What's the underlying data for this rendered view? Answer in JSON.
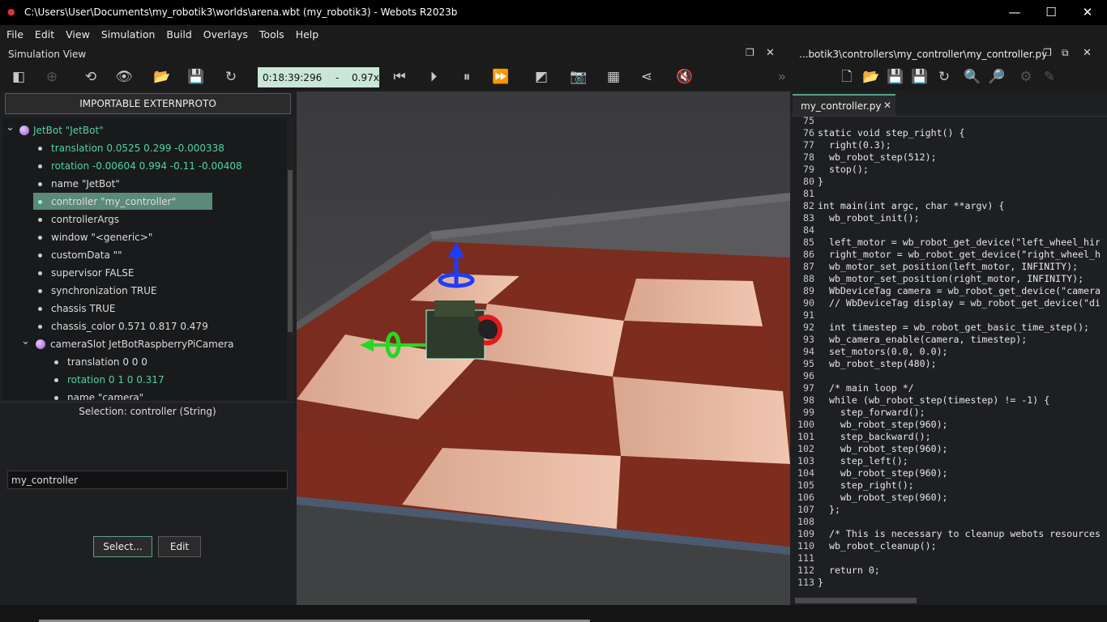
{
  "window": {
    "title": "C:\\Users\\User\\Documents\\my_robotik3\\worlds\\arena.wbt (my_robotik3) - Webots R2023b"
  },
  "menu": [
    "File",
    "Edit",
    "View",
    "Simulation",
    "Build",
    "Overlays",
    "Tools",
    "Help"
  ],
  "sim_view": {
    "title": "Simulation View",
    "time": "0:18:39:296",
    "sep": "-",
    "speed": "0.97x",
    "importable_button": "IMPORTABLE EXTERNPROTO"
  },
  "scene_tree": [
    {
      "label": "JetBot \"JetBot\"",
      "kind": "sphere",
      "level": 0,
      "expanded": true
    },
    {
      "label": "translation 0.0525 0.299 -0.000338",
      "kind": "field",
      "level": 1,
      "green": true
    },
    {
      "label": "rotation -0.00604 0.994 -0.11 -0.00408",
      "kind": "field",
      "level": 1,
      "green": true
    },
    {
      "label": "name \"JetBot\"",
      "kind": "field",
      "level": 1
    },
    {
      "label": "controller \"my_controller\"",
      "kind": "field",
      "level": 1,
      "selected": true
    },
    {
      "label": "controllerArgs",
      "kind": "field",
      "level": 1
    },
    {
      "label": "window \"<generic>\"",
      "kind": "field",
      "level": 1
    },
    {
      "label": "customData \"\"",
      "kind": "field",
      "level": 1
    },
    {
      "label": "supervisor FALSE",
      "kind": "field",
      "level": 1
    },
    {
      "label": "synchronization TRUE",
      "kind": "field",
      "level": 1
    },
    {
      "label": "chassis TRUE",
      "kind": "field",
      "level": 1
    },
    {
      "label": "chassis_color 0.571 0.817 0.479",
      "kind": "field",
      "level": 1
    },
    {
      "label": "cameraSlot JetBotRaspberryPiCamera",
      "kind": "sphere",
      "level": 1,
      "expanded": true
    },
    {
      "label": "translation 0 0 0",
      "kind": "field",
      "level": 2
    },
    {
      "label": "rotation 0 1 0 0.317",
      "kind": "field",
      "level": 2,
      "green": true
    },
    {
      "label": "name \"camera\"",
      "kind": "field",
      "level": 2
    }
  ],
  "field_editor": {
    "selection_label": "Selection: controller (String)",
    "value": "my_controller",
    "select_button": "Select...",
    "edit_button": "Edit"
  },
  "editor": {
    "title": "...botik3\\controllers\\my_controller\\my_controller.py",
    "tab": "my_controller.py",
    "lines": [
      {
        "n": "75",
        "t": ""
      },
      {
        "n": "76",
        "t": "static void step_right() {"
      },
      {
        "n": "77",
        "t": "  right(0.3);"
      },
      {
        "n": "78",
        "t": "  wb_robot_step(512);"
      },
      {
        "n": "79",
        "t": "  stop();"
      },
      {
        "n": "80",
        "t": "}"
      },
      {
        "n": "81",
        "t": ""
      },
      {
        "n": "82",
        "t": "int main(int argc, char **argv) {"
      },
      {
        "n": "83",
        "t": "  wb_robot_init();"
      },
      {
        "n": "84",
        "t": ""
      },
      {
        "n": "85",
        "t": "  left_motor = wb_robot_get_device(\"left_wheel_hir"
      },
      {
        "n": "86",
        "t": "  right_motor = wb_robot_get_device(\"right_wheel_h"
      },
      {
        "n": "87",
        "t": "  wb_motor_set_position(left_motor, INFINITY);"
      },
      {
        "n": "88",
        "t": "  wb_motor_set_position(right_motor, INFINITY);"
      },
      {
        "n": "89",
        "t": "  WbDeviceTag camera = wb_robot_get_device(\"camera"
      },
      {
        "n": "90",
        "t": "  // WbDeviceTag display = wb_robot_get_device(\"di"
      },
      {
        "n": "91",
        "t": ""
      },
      {
        "n": "92",
        "t": "  int timestep = wb_robot_get_basic_time_step();"
      },
      {
        "n": "93",
        "t": "  wb_camera_enable(camera, timestep);"
      },
      {
        "n": "94",
        "t": "  set_motors(0.0, 0.0);"
      },
      {
        "n": "95",
        "t": "  wb_robot_step(480);"
      },
      {
        "n": "96",
        "t": ""
      },
      {
        "n": "97",
        "t": "  /* main loop */"
      },
      {
        "n": "98",
        "t": "  while (wb_robot_step(timestep) != -1) {"
      },
      {
        "n": "99",
        "t": "    step_forward();"
      },
      {
        "n": "100",
        "t": "    wb_robot_step(960);"
      },
      {
        "n": "101",
        "t": "    step_backward();"
      },
      {
        "n": "102",
        "t": "    wb_robot_step(960);"
      },
      {
        "n": "103",
        "t": "    step_left();"
      },
      {
        "n": "104",
        "t": "    wb_robot_step(960);"
      },
      {
        "n": "105",
        "t": "    step_right();"
      },
      {
        "n": "106",
        "t": "    wb_robot_step(960);"
      },
      {
        "n": "107",
        "t": "  };"
      },
      {
        "n": "108",
        "t": ""
      },
      {
        "n": "109",
        "t": "  /* This is necessary to cleanup webots resources"
      },
      {
        "n": "110",
        "t": "  wb_robot_cleanup();"
      },
      {
        "n": "111",
        "t": ""
      },
      {
        "n": "112",
        "t": "  return 0;"
      },
      {
        "n": "113",
        "t": "}"
      }
    ]
  },
  "colors": {
    "accent_green": "#4ed4a0",
    "clock_bg": "#c9e6d8",
    "selected_bg": "#5c8a7a"
  }
}
